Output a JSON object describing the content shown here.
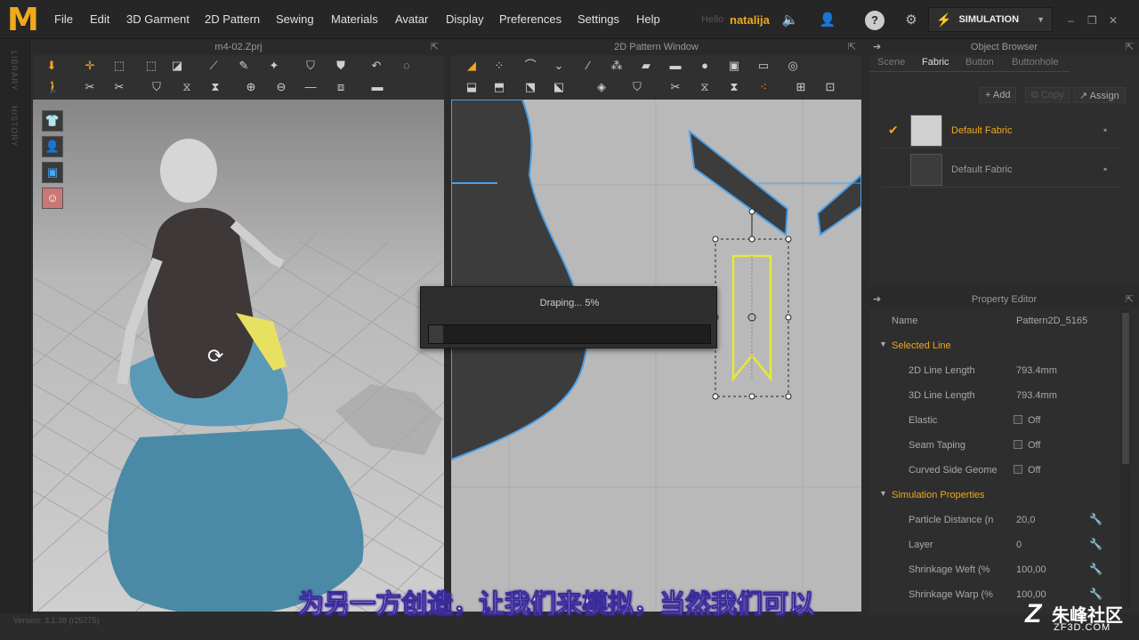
{
  "menubar": {
    "logo": "M",
    "items": [
      "File",
      "Edit",
      "3D Garment",
      "2D Pattern",
      "Sewing",
      "Materials",
      "Avatar",
      "Display",
      "Preferences",
      "Settings",
      "Help"
    ],
    "hello": "Hello",
    "user": "natalija",
    "simulation_label": "SIMULATION"
  },
  "left_strip": {
    "library": "LIBRARY",
    "history": "HISTORY"
  },
  "view3d": {
    "title": "m4-02.Zprj"
  },
  "view2d": {
    "title": "2D Pattern Window"
  },
  "dialog": {
    "text": "Draping... 5%",
    "progress": 0.05
  },
  "object_browser": {
    "title": "Object Browser",
    "tabs": [
      "Scene",
      "Fabric",
      "Button",
      "Buttonhole"
    ],
    "active_tab": "Fabric",
    "buttons": {
      "add": "Add",
      "copy": "Copy",
      "assign": "Assign"
    },
    "fabrics": [
      {
        "name": "Default Fabric",
        "selected": true,
        "color": "#d0d0d0"
      },
      {
        "name": "Default Fabric",
        "selected": false,
        "color": "#3c3c3c"
      }
    ]
  },
  "property_editor": {
    "title": "Property Editor",
    "name_label": "Name",
    "name_value": "Pattern2D_5165",
    "selected_line": {
      "heading": "Selected Line",
      "rows": [
        {
          "label": "2D Line Length",
          "value": "793.4mm"
        },
        {
          "label": "3D Line Length",
          "value": "793.4mm"
        },
        {
          "label": "Elastic",
          "value": "Off"
        },
        {
          "label": "Seam Taping",
          "value": "Off"
        },
        {
          "label": "Curved Side Geome",
          "value": "Off"
        }
      ]
    },
    "simulation": {
      "heading": "Simulation Properties",
      "rows": [
        {
          "label": "Particle Distance (n",
          "value": "20,0"
        },
        {
          "label": "Layer",
          "value": "0"
        },
        {
          "label": "Shrinkage Weft (%",
          "value": "100,00"
        },
        {
          "label": "Shrinkage Warp (%",
          "value": "100,00"
        }
      ]
    }
  },
  "subtitle": "为另一方创造，让我们来模拟，当然我们可以",
  "watermark": {
    "brand": "朱峰社区",
    "site": "ZF3D.COM"
  },
  "version": "Version: 3.1.38 (r25775)",
  "colors": {
    "accent": "#f0a81c",
    "garment_blue": "#4a8aa6",
    "outline_blue": "#4aa0e8",
    "selection_yellow": "#e8e83a"
  }
}
